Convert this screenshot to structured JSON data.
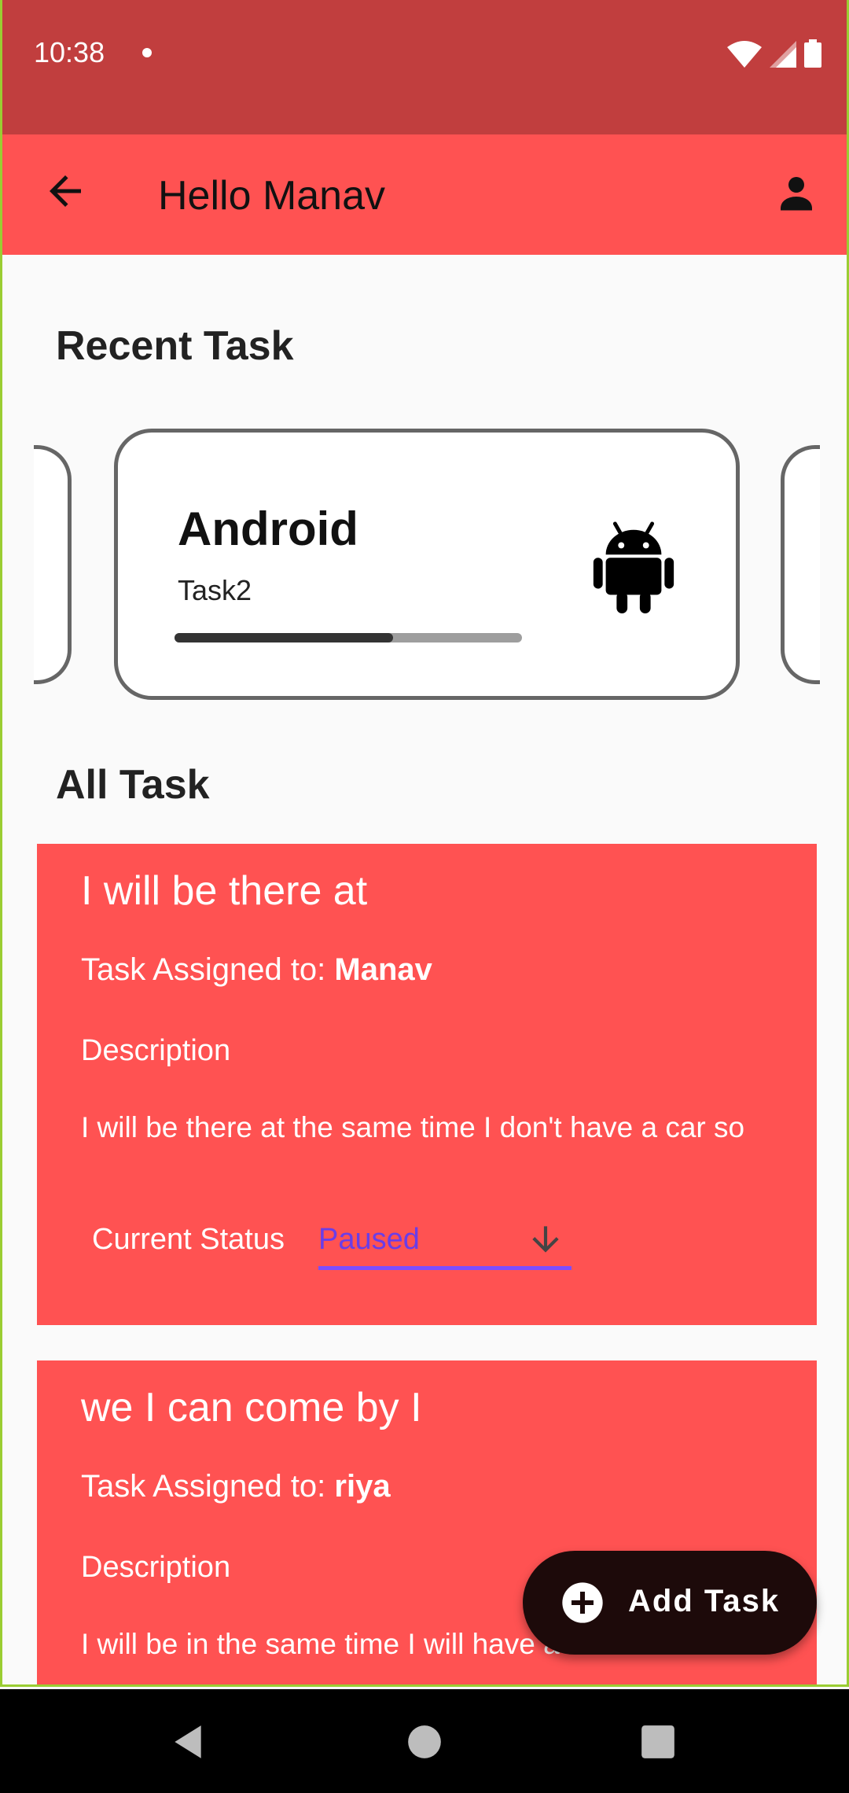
{
  "status_bar": {
    "time": "10:38"
  },
  "app_bar": {
    "title": "Hello Manav"
  },
  "recent": {
    "section_title": "Recent Task",
    "card": {
      "title": "Android",
      "subtitle": "Task2",
      "progress": 0.63,
      "icon": "android-icon"
    }
  },
  "all": {
    "section_title": "All Task"
  },
  "tasks": [
    {
      "title": "I will be there at",
      "assigned_prefix": "Task Assigned to: ",
      "assignee": "Manav",
      "description_label": "Description",
      "description": "I will be there at the same time I don't have a car so",
      "status_label": "Current Status",
      "status_value": "Paused"
    },
    {
      "title": "we I can come by I",
      "assigned_prefix": "Task Assigned to: ",
      "assignee": "riya",
      "description_label": "Description",
      "description": "I will be in the same time I will have a car so we"
    }
  ],
  "fab": {
    "label": "Add Task",
    "icon": "add-circle-icon"
  },
  "colors": {
    "primary": "#ff5252",
    "status_bar": "#c13e3e",
    "accent": "#7c4dff",
    "fab": "#1d0a0a"
  }
}
